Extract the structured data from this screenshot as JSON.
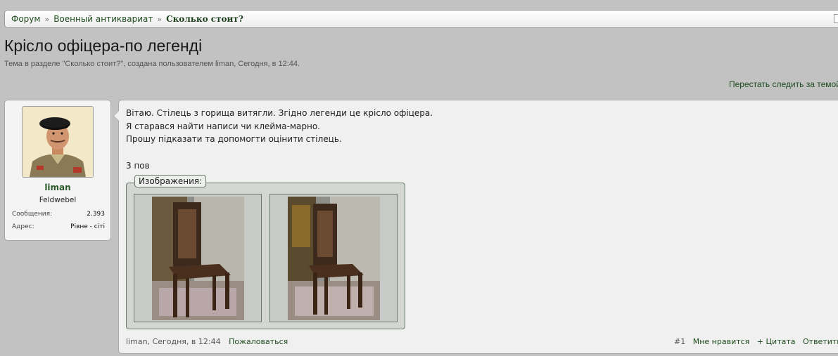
{
  "breadcrumb": {
    "items": [
      "Форум",
      "Военный антиквариат",
      "Сколько стоит?"
    ],
    "separator": "»"
  },
  "thread": {
    "title": "Крісло офіцера-по легенді",
    "meta": "Тема в разделе \"Сколько стоит?\", создана пользователем liman, Сегодня, в 12:44.",
    "watch_label": "Перестать следить за темой"
  },
  "user": {
    "name": "liman",
    "rank": "Feldwebel",
    "stats": [
      {
        "label": "Сообщения:",
        "value": "2.393"
      },
      {
        "label": "Адрес:",
        "value": "Рівне - сіті"
      }
    ]
  },
  "post": {
    "lines": [
      "Вітаю. Стілець з горища витягли. Згідно легенди це крісло офіцера.",
      "Я старався найти написи чи клейма-марно.",
      "Прошу підказати та допомогти оцінити стілець.",
      "3 пов"
    ],
    "attachments_label": "Изображения:",
    "author_time": "liman, Сегодня, в 12:44",
    "report_label": "Пожаловаться",
    "post_number": "#1",
    "like_label": "Мне нравится",
    "quote_label": "+ Цитата",
    "reply_label": "Ответить"
  },
  "colors": {
    "background": "#c2c2c2",
    "link": "#1f4d1f",
    "username": "#2b5a2b",
    "attachment_border": "#6b7a6b"
  }
}
